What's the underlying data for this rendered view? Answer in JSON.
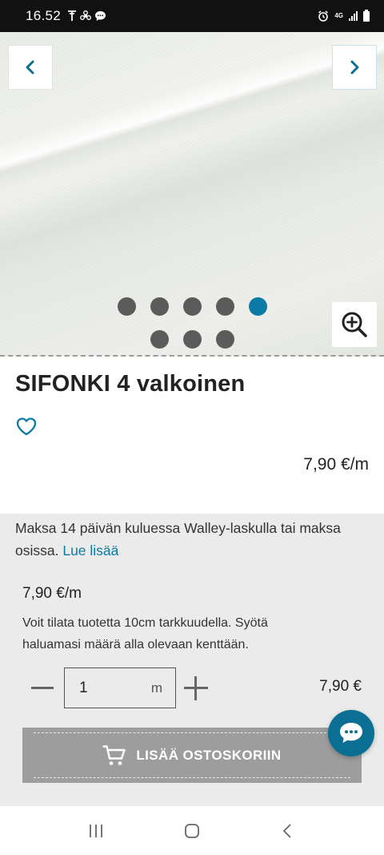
{
  "status_bar": {
    "time": "16.52",
    "network": "4G"
  },
  "gallery": {
    "dots_row1": [
      false,
      false,
      false,
      false,
      true
    ],
    "dots_row2": [
      false,
      false,
      false
    ]
  },
  "product": {
    "title": "SIFONKI 4 valkoinen",
    "price": "7,90 €/m"
  },
  "payment_info": {
    "text": "Maksa 14 päivän kuluessa Walley-laskulla tai maksa osissa.",
    "link_label": "Lue lisää"
  },
  "order": {
    "unit_price": "7,90 €/m",
    "info": "Voit tilata tuotetta 10cm tarkkuudella. Syötä haluamasi määrä alla olevaan kenttään.",
    "quantity": "1",
    "unit": "m",
    "line_total": "7,90 €",
    "add_to_cart_label": "LISÄÄ OSTOSKORIIN"
  },
  "colors": {
    "accent": "#0b7aa5",
    "chat": "#0b6f93",
    "cart_button": "#9d9d9d",
    "panel": "#ebebeb"
  },
  "icons": {
    "prev": "chevron-left-icon",
    "next": "chevron-right-icon",
    "zoom": "zoom-in-icon",
    "favorite": "heart-icon",
    "cart": "cart-icon",
    "chat": "chat-icon"
  }
}
